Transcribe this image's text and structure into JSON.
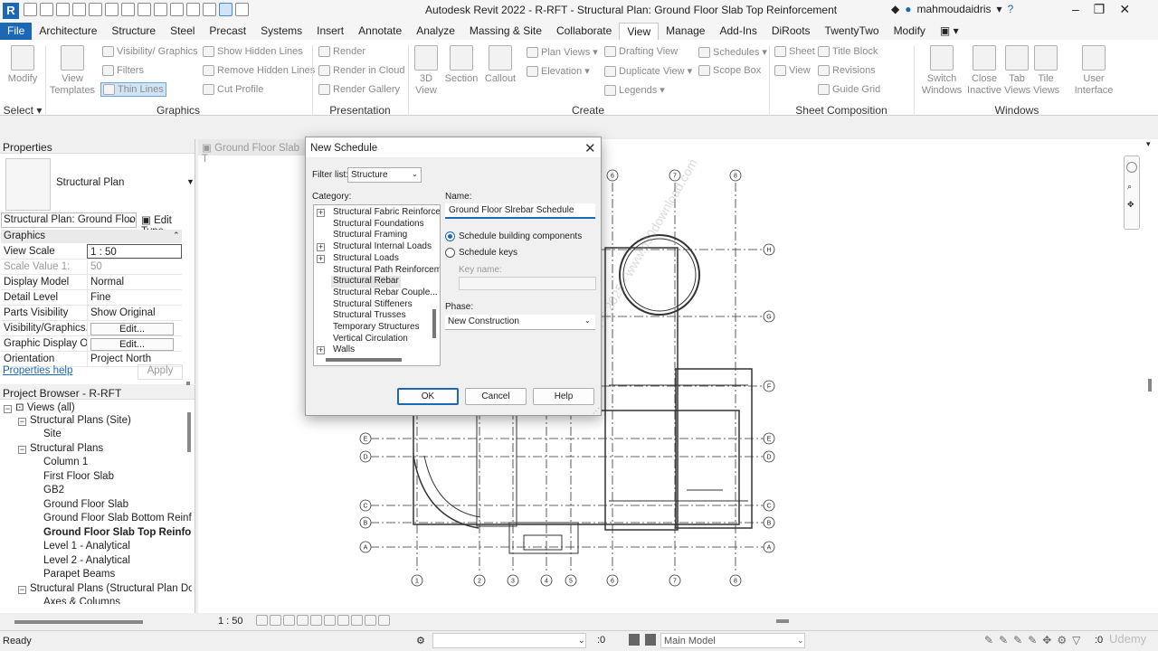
{
  "window": {
    "title": "Autodesk Revit 2022 - R-RFT - Structural Plan: Ground Floor Slab Top Reinforcement",
    "user": "mahmoudaidris"
  },
  "tabs": [
    "File",
    "Architecture",
    "Structure",
    "Steel",
    "Precast",
    "Systems",
    "Insert",
    "Annotate",
    "Analyze",
    "Massing & Site",
    "Collaborate",
    "View",
    "Manage",
    "Add-Ins",
    "DiRoots",
    "TwentyTwo",
    "Modify"
  ],
  "active_tab": "View",
  "ribbon": {
    "select": {
      "modify": "Modify",
      "label": "Select"
    },
    "graphics": {
      "label": "Graphics",
      "view_templates": "View Templates",
      "visibility_graphics": "Visibility/ Graphics",
      "filters": "Filters",
      "thin_lines": "Thin Lines",
      "show_hidden_lines": "Show Hidden Lines",
      "remove_hidden_lines": "Remove Hidden Lines",
      "cut_profile": "Cut Profile"
    },
    "presentation": {
      "label": "Presentation",
      "render": "Render",
      "render_in_cloud": "Render in Cloud",
      "render_gallery": "Render Gallery"
    },
    "create": {
      "label": "Create",
      "three_d_view": "3D View",
      "section": "Section",
      "callout": "Callout",
      "plan_views": "Plan Views",
      "elevation": "Elevation",
      "drafting_view": "Drafting View",
      "duplicate_view": "Duplicate View",
      "legends": "Legends",
      "schedules": "Schedules",
      "scope_box": "Scope Box"
    },
    "sheet_composition": {
      "label": "Sheet Composition",
      "sheet": "Sheet",
      "view": "View",
      "title_block": "Title Block",
      "revisions": "Revisions",
      "guide_grid": "Guide Grid"
    },
    "windows": {
      "label": "Windows",
      "switch_windows": "Switch Windows",
      "close_inactive": "Close Inactive",
      "tab_views": "Tab Views",
      "tile_views": "Tile Views",
      "user_interface": "User Interface"
    }
  },
  "properties": {
    "title": "Properties",
    "type_name": "Structural Plan",
    "instance_selector": "Structural Plan: Ground Floor",
    "edit_type": "Edit Type",
    "section": "Graphics",
    "rows": [
      {
        "key": "View Scale",
        "value": "1 : 50"
      },
      {
        "key": "Scale Value    1:",
        "value": "50"
      },
      {
        "key": "Display Model",
        "value": "Normal"
      },
      {
        "key": "Detail Level",
        "value": "Fine"
      },
      {
        "key": "Parts Visibility",
        "value": "Show Original"
      },
      {
        "key": "Visibility/Graphics...",
        "value": "Edit..."
      },
      {
        "key": "Graphic Display O...",
        "value": "Edit..."
      },
      {
        "key": "Orientation",
        "value": "Project North"
      }
    ],
    "help": "Properties help",
    "apply": "Apply"
  },
  "project_browser": {
    "title": "Project Browser - R-RFT",
    "items": [
      {
        "label": "Views (all)",
        "level": 0,
        "type": "root"
      },
      {
        "label": "Structural Plans (Site)",
        "level": 1,
        "type": "group"
      },
      {
        "label": "Site",
        "level": 2,
        "type": "leaf"
      },
      {
        "label": "Structural Plans",
        "level": 1,
        "type": "group"
      },
      {
        "label": "Column 1",
        "level": 2,
        "type": "leaf"
      },
      {
        "label": "First Floor Slab",
        "level": 2,
        "type": "leaf"
      },
      {
        "label": "GB2",
        "level": 2,
        "type": "leaf"
      },
      {
        "label": "Ground Floor Slab",
        "level": 2,
        "type": "leaf"
      },
      {
        "label": "Ground Floor Slab Bottom Reinfo",
        "level": 2,
        "type": "leaf"
      },
      {
        "label": "Ground Floor Slab Top Reinforc",
        "level": 2,
        "type": "leaf",
        "bold": true
      },
      {
        "label": "Level 1 - Analytical",
        "level": 2,
        "type": "leaf"
      },
      {
        "label": "Level 2 - Analytical",
        "level": 2,
        "type": "leaf"
      },
      {
        "label": "Parapet Beams",
        "level": 2,
        "type": "leaf"
      },
      {
        "label": "Structural Plans (Structural Plan Dow",
        "level": 1,
        "type": "group"
      },
      {
        "label": "Axes & Columns",
        "level": 2,
        "type": "leaf"
      }
    ]
  },
  "view_tab": "Ground Floor Slab T",
  "dialog": {
    "title": "New Schedule",
    "filter_label": "Filter list:",
    "filter_value": "Structure",
    "category_label": "Category:",
    "categories": [
      {
        "label": "Structural Fabric Reinforce",
        "expand": true
      },
      {
        "label": "Structural Foundations",
        "expand": false
      },
      {
        "label": "Structural Framing",
        "expand": false
      },
      {
        "label": "Structural Internal Loads",
        "expand": true
      },
      {
        "label": "Structural Loads",
        "expand": true
      },
      {
        "label": "Structural Path Reinforcem",
        "expand": false
      },
      {
        "label": "Structural Rebar",
        "expand": false,
        "selected": true
      },
      {
        "label": "Structural Rebar Couple...",
        "expand": false
      },
      {
        "label": "Structural Stiffeners",
        "expand": false
      },
      {
        "label": "Structural Trusses",
        "expand": false
      },
      {
        "label": "Temporary Structures",
        "expand": false
      },
      {
        "label": "Vertical Circulation",
        "expand": false
      },
      {
        "label": "Walls",
        "expand": true
      }
    ],
    "name_label": "Name:",
    "name_value": "Ground Floor Slrebar Schedule",
    "radio_building": "Schedule building components",
    "radio_keys": "Schedule keys",
    "key_name_label": "Key name:",
    "phase_label": "Phase:",
    "phase_value": "New Construction",
    "ok": "OK",
    "cancel": "Cancel",
    "help": "Help"
  },
  "drawing": {
    "grid_top": [
      "6",
      "7",
      "8"
    ],
    "grid_bottom": [
      "1",
      "2",
      "3",
      "4",
      "5",
      "6",
      "7",
      "8"
    ],
    "grid_right": [
      "H",
      "G",
      "F",
      "E",
      "D",
      "C",
      "B",
      "A"
    ],
    "grid_left": [
      "E",
      "D",
      "C",
      "B",
      "A"
    ],
    "watermark": "Copyright © 2025 - www.p30download.com"
  },
  "view_control": {
    "scale": "1 : 50"
  },
  "status": {
    "ready": "Ready",
    "zero": ":0",
    "model": "Main Model",
    "zero2": ":0"
  },
  "brand": "Udemy"
}
